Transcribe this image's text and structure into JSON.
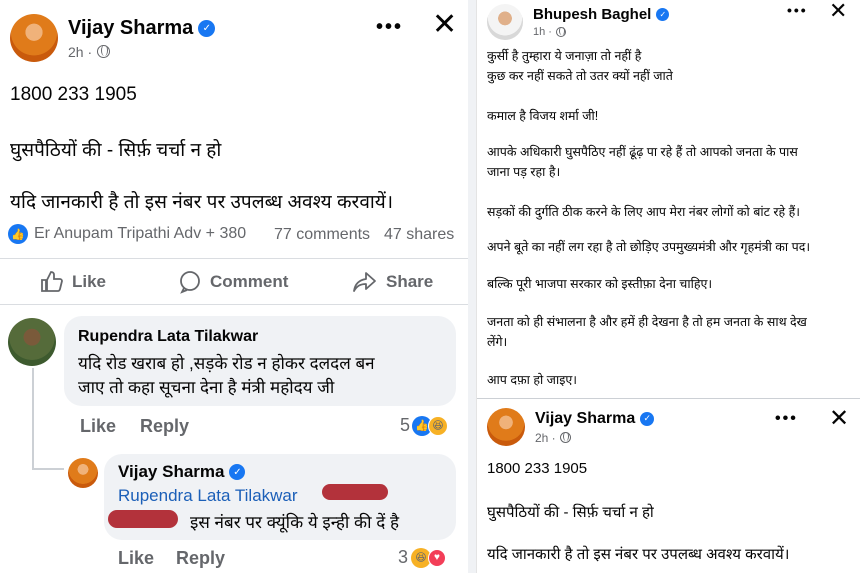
{
  "left": {
    "post": {
      "author": "Vijay Sharma",
      "time": "2h ·",
      "lines": [
        "1800 233 1905",
        "घुसपैठियों की - सिर्फ़ चर्चा न हो",
        "यदि जानकारी है तो इस नंबर पर उपलब्ध अवश्य  करवायें।"
      ],
      "reactors": "Er Anupam Tripathi Adv + 380",
      "comments": "77 comments",
      "shares": "47 shares",
      "actions": {
        "like": "Like",
        "comment": "Comment",
        "share": "Share"
      }
    },
    "comment1": {
      "author": "Rupendra Lata Tilakwar",
      "text": "यदि रोड खराब हो ,सड़के रोड न होकर दलदल बन\nजाए तो कहा सूचना देना है मंत्री महोदय जी",
      "like": "Like",
      "reply": "Reply",
      "count": "5"
    },
    "reply1": {
      "author": "Vijay Sharma",
      "mention": "Rupendra Lata Tilakwar",
      "text": "इस नंबर पर क्यूंकि ये इन्ही की दें है",
      "like": "Like",
      "reply": "Reply",
      "count": "3"
    }
  },
  "right": {
    "post": {
      "author": "Bhupesh Baghel",
      "time": "1h ·",
      "paragraphs": [
        "कुर्सी है तुम्हारा ये जनाज़ा तो नहीं है\nकुछ कर नहीं सकते तो उतर क्यों नहीं जाते",
        "कमाल है विजय शर्मा जी!",
        "आपके अधिकारी घुसपैठिए नहीं ढूंढ़ पा रहे हैं तो आपको जनता के पास\nजाना पड़ रहा है।",
        "सड़कों की दुर्गति ठीक करने के लिए  आप मेरा नंबर लोगों को बांट रहे हैं।",
        "अपने बूते का नहीं लग रहा है तो छोड़िए उपमुख्यमंत्री और गृहमंत्री का पद।",
        "बल्कि पूरी भाजपा सरकार को इस्तीफ़ा देना चाहिए।",
        "जनता को ही संभालना है और हमें ही देखना है तो हम जनता के साथ देख\nलेंगे।",
        "आप दफ़ा हो जाइए।"
      ]
    },
    "quoted": {
      "author": "Vijay Sharma",
      "time": "2h ·",
      "lines": [
        "1800 233 1905",
        "घुसपैठियों की - सिर्फ़ चर्चा न हो",
        "यदि जानकारी है तो इस नंबर पर उपलब्ध अवश्य  करवायें।"
      ]
    }
  },
  "icons": {
    "verified": "verified-check-icon",
    "globe": "globe-icon",
    "more": "more-dots-icon",
    "close": "close-icon"
  },
  "colors": {
    "facebook_blue": "#1877f2",
    "meta_gray": "#65676b",
    "bubble": "#f0f2f5"
  }
}
